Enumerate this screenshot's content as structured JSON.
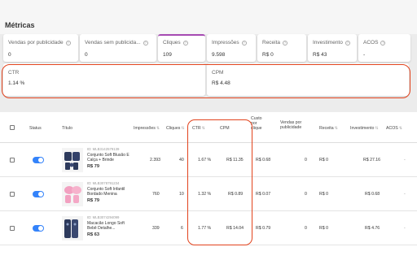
{
  "page_title": "Métricas",
  "metric_cards": [
    {
      "label": "Vendas por publicidade",
      "value": "0"
    },
    {
      "label": "Vendas sem publicida...",
      "value": "0"
    },
    {
      "label": "Cliques",
      "value": "109"
    },
    {
      "label": "Impressões",
      "value": "9.598"
    },
    {
      "label": "Receita",
      "value": "R$ 0"
    },
    {
      "label": "Investimento",
      "value": "R$ 43"
    },
    {
      "label": "ACOS",
      "value": "-"
    }
  ],
  "expanded_metrics": [
    {
      "label": "CTR",
      "value": "1.14 %"
    },
    {
      "label": "CPM",
      "value": "R$ 4.48"
    }
  ],
  "table": {
    "headers": {
      "status": "Status",
      "titulo": "Título",
      "impressoes": "Impressões",
      "cliques": "Cliques",
      "ctr": "CTR",
      "cpm": "CPM",
      "custo_por_clique": "Custo por clique",
      "vendas_por_publicidade": "Vendas por publicidade",
      "receita": "Receita",
      "investimento": "Investimento",
      "acos": "ACOS"
    },
    "sort_icon": "⇅",
    "rows": [
      {
        "id": "ID: MLB3142579139",
        "title": "Conjunto Soft Blusão E Calça + Brinde",
        "price": "R$ 79",
        "impressoes": "2.393",
        "cliques": "40",
        "ctr": "1.67 %",
        "cpm": "R$ 11.35",
        "custo_por_clique": "R$ 0.68",
        "vendas_por_publicidade": "0",
        "receita": "R$ 0",
        "investimento": "R$ 27.16",
        "acos": "-"
      },
      {
        "id": "ID: MLB3078791234",
        "title": "Conjunto Soft Infantil Bordado Menina",
        "price": "R$ 79",
        "impressoes": "760",
        "cliques": "10",
        "ctr": "1.32 %",
        "cpm": "R$ 0.89",
        "custo_por_clique": "R$ 0.07",
        "vendas_por_publicidade": "0",
        "receita": "R$ 0",
        "investimento": "R$ 0.68",
        "acos": "-"
      },
      {
        "id": "ID: MLB3074294099",
        "title": "Macacão Longo Soft Bebê Detalhe...",
        "price": "R$ 63",
        "impressoes": "339",
        "cliques": "6",
        "ctr": "1.77 %",
        "cpm": "R$ 14.04",
        "custo_por_clique": "R$ 0.79",
        "vendas_por_publicidade": "0",
        "receita": "R$ 0",
        "investimento": "R$ 4.76",
        "acos": "-"
      }
    ]
  },
  "colors": {
    "accent_purple": "#a64ab2",
    "toggle_blue": "#3483fa",
    "highlight_orange": "#e2431d",
    "navy_product": "#2d3a5c",
    "pink_product": "#f2a0c0"
  }
}
